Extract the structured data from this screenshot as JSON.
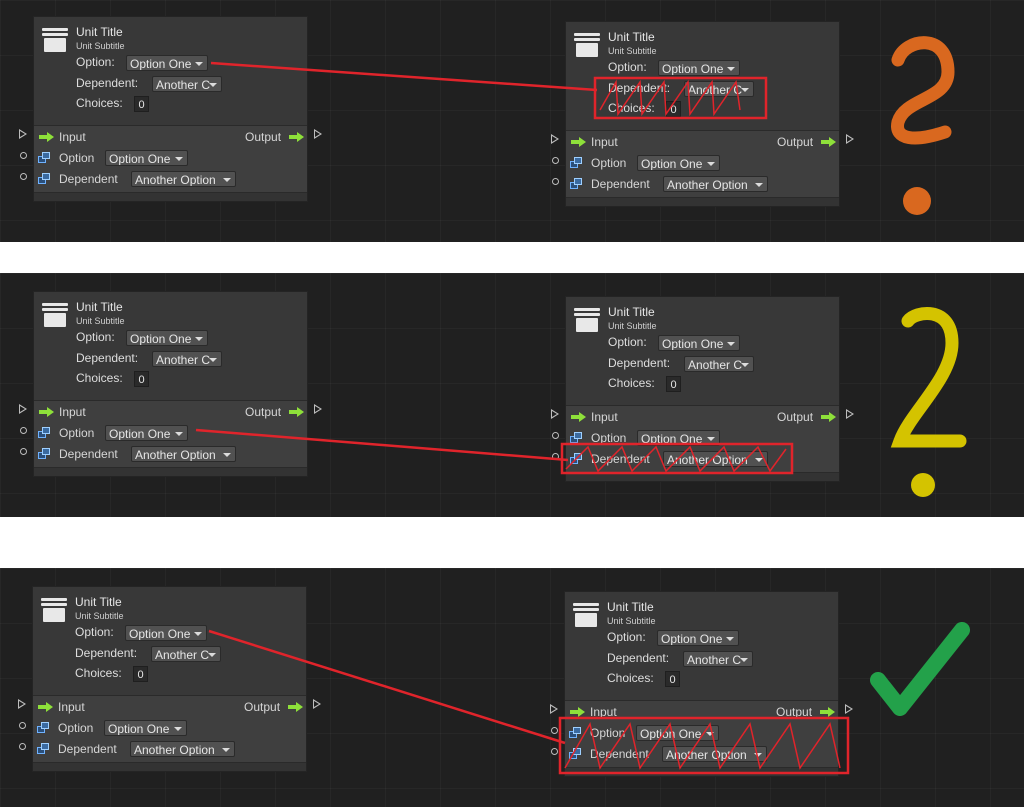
{
  "node": {
    "title": "Unit Title",
    "subtitle": "Unit Subtitle",
    "option_label": "Option:",
    "option_value": "Option One",
    "dependent_label": "Dependent:",
    "dependent_value": "Another C",
    "choices_label": "Choices:",
    "choices_value": "0",
    "input_label": "Input",
    "output_label": "Output",
    "port_option_label": "Option",
    "port_option_value": "Option One",
    "port_dependent_label": "Dependent",
    "port_dependent_value": "Another Option"
  },
  "colors": {
    "connection": "#e0242b",
    "question_orange": "#d9681f",
    "question_yellow": "#d4c300",
    "check_green": "#23a14a",
    "flow_arrow": "#8ee03a"
  },
  "icons": [
    "unit-icon",
    "flow-arrow-icon",
    "port-icon",
    "question-mark-icon",
    "checkmark-icon"
  ]
}
